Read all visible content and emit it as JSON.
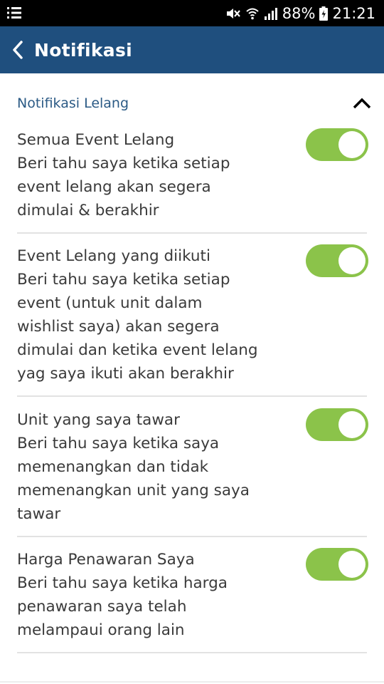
{
  "status": {
    "battery": "88%",
    "time": "21:21"
  },
  "appbar": {
    "title": "Notifikasi"
  },
  "section": {
    "title": "Notifikasi Lelang"
  },
  "items": [
    {
      "title": "Semua Event Lelang",
      "desc_lines": [
        "Beri tahu saya ketika setiap",
        "event lelang akan segera",
        "dimulai & berakhir"
      ],
      "enabled": true
    },
    {
      "title": "Event Lelang yang diikuti",
      "desc_lines": [
        "Beri tahu saya ketika setiap",
        "event (untuk unit dalam",
        "wishlist saya) akan segera",
        "dimulai dan ketika event lelang",
        "yag saya ikuti akan berakhir"
      ],
      "enabled": true
    },
    {
      "title": "Unit yang saya tawar",
      "desc_lines": [
        "Beri tahu saya ketika saya",
        "memenangkan dan tidak",
        "memenangkan unit yang saya",
        "tawar"
      ],
      "enabled": true
    },
    {
      "title": "Harga Penawaran Saya",
      "desc_lines": [
        "Beri tahu saya ketika harga",
        "penawaran saya telah",
        "melampaui orang lain"
      ],
      "enabled": true
    }
  ],
  "colors": {
    "appbar": "#1f4f7e",
    "toggle_on": "#8bc34a",
    "section_title": "#2b5a85"
  },
  "icons": {
    "status_menu": "menu-lines-icon",
    "mute": "mute-icon",
    "wifi": "wifi-icon",
    "signal": "signal-icon",
    "battery": "battery-icon",
    "back": "back-arrow-icon",
    "collapse": "chevron-up-icon"
  }
}
